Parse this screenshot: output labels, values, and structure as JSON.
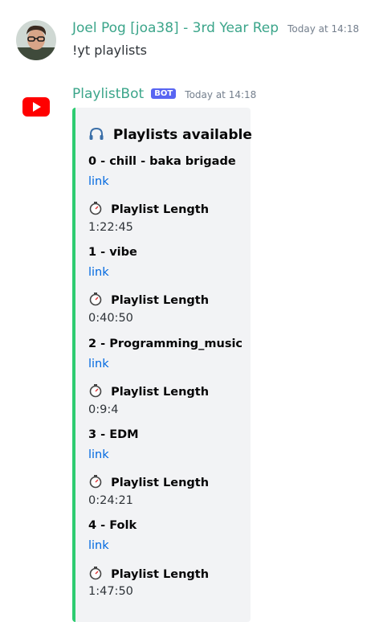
{
  "messages": [
    {
      "author": "Joel Pog [joa38] - 3rd Year Rep",
      "timestamp": "Today at 14:18",
      "content": "!yt playlists"
    },
    {
      "author": "PlaylistBot",
      "bot_tag": "BOT",
      "timestamp": "Today at 14:18",
      "embed": {
        "title": "Playlists available",
        "border_color": "#2ecc71",
        "playlists": [
          {
            "name": "0 - chill - baka brigade",
            "link_label": "link",
            "length_label": "Playlist Length",
            "length": "1:22:45"
          },
          {
            "name": "1 - vibe",
            "link_label": "link",
            "length_label": "Playlist Length",
            "length": "0:40:50"
          },
          {
            "name": "2 - Programming_music",
            "link_label": "link",
            "length_label": "Playlist Length",
            "length": "0:9:4"
          },
          {
            "name": "3 - EDM",
            "link_label": "link",
            "length_label": "Playlist Length",
            "length": "0:24:21"
          },
          {
            "name": "4 - Folk",
            "link_label": "link",
            "length_label": "Playlist Length",
            "length": "1:47:50"
          }
        ]
      }
    }
  ],
  "colors": {
    "username": "#3ba58a",
    "bot_tag": "#5865f2",
    "link": "#0068e0"
  },
  "icons": {
    "title": "headphones-icon",
    "length": "stopwatch-icon",
    "bot_avatar": "youtube-icon"
  }
}
